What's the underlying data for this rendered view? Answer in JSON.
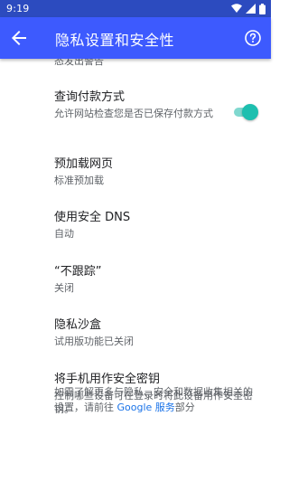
{
  "status_bar": {
    "time": "9:19",
    "icons": [
      "wifi-icon",
      "signal-icon",
      "battery-icon"
    ]
  },
  "app_bar": {
    "title": "隐私设置和安全性",
    "back_icon": "back-arrow-icon",
    "help_icon": "help-icon"
  },
  "cut_off_summary": "态发出警告",
  "settings": [
    {
      "title": "查询付款方式",
      "summary": "允许网站检查您是否已保存付款方式",
      "toggle": true
    },
    {
      "title": "预加载网页",
      "summary": "标准预加载"
    },
    {
      "title": "使用安全 DNS",
      "summary": "自动"
    },
    {
      "title": "“不跟踪”",
      "summary": "关闭"
    },
    {
      "title": "隐私沙盒",
      "summary": "试用版功能已关闭"
    },
    {
      "title": "将手机用作安全密钥",
      "summary": "控制哪些设备可在登录时将此设备用作安全密钥。"
    }
  ],
  "footer": {
    "text_before": "如需了解更多与隐私、安全和数据收集相关的设置，请前往 ",
    "link_text": "Google 服务",
    "text_after": "部分"
  },
  "colors": {
    "app_bar": "#3d5afe",
    "status_bar": "#2c4bbf",
    "toggle_on": "#1dbfaf",
    "link": "#1a73e8"
  }
}
